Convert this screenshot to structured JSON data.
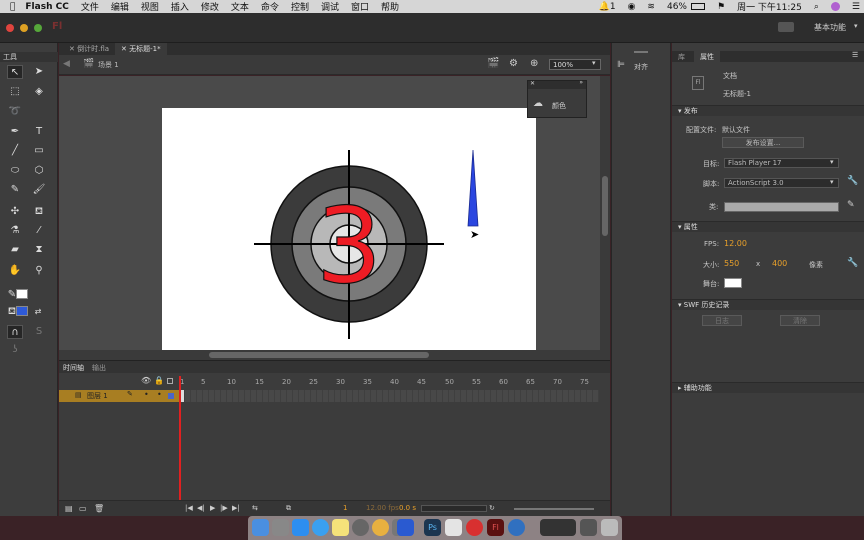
{
  "menubar": {
    "apple": "",
    "app": "Flash CC",
    "menus": [
      "文件",
      "编辑",
      "视图",
      "插入",
      "修改",
      "文本",
      "命令",
      "控制",
      "调试",
      "窗口",
      "帮助"
    ],
    "notification_count": "1",
    "battery": "46%",
    "clock": "周一 下午11:25"
  },
  "appbar": {
    "logo": "Fl",
    "workspace": "基本功能"
  },
  "tools": {
    "panel_title": "工具"
  },
  "tabs": {
    "doc1": "倒计时.fla",
    "doc2": "无标题-1*"
  },
  "editbar": {
    "scene": "场景 1",
    "zoom": "100%"
  },
  "color_panel": {
    "label": "颜色"
  },
  "stage": {
    "countdown_digit": "3"
  },
  "timeline": {
    "tab_timeline": "时间轴",
    "tab_output": "输出",
    "layer_name": "图层 1",
    "frame_ticks": [
      "1",
      "5",
      "10",
      "15",
      "20",
      "25",
      "30",
      "35",
      "40",
      "45",
      "50",
      "55",
      "60",
      "65",
      "70",
      "75"
    ],
    "current_frame": "1",
    "fps": "12.00 fps",
    "time": "0.0 s"
  },
  "align_panel": {
    "label": "对齐"
  },
  "props": {
    "tab_library": "库",
    "tab_properties": "属性",
    "doc_type": "文档",
    "doc_name": "无标题-1",
    "publish": {
      "header": "发布",
      "profile_label": "配置文件:",
      "profile_value": "默认文件",
      "settings_button": "发布设置...",
      "target_label": "目标:",
      "target_value": "Flash Player 17",
      "script_label": "脚本:",
      "script_value": "ActionScript 3.0",
      "class_label": "类:"
    },
    "properties": {
      "header": "属性",
      "fps_label": "FPS:",
      "fps_value": "12.00",
      "size_label": "大小:",
      "width": "550",
      "x": "x",
      "height": "400",
      "unit": "像素",
      "stage_label": "舞台:",
      "stage_color": "#ffffff"
    },
    "swf": {
      "header": "SWF 历史记录",
      "log_button": "日志",
      "clear_button": "清除"
    },
    "accessibility": {
      "header": "辅助功能"
    }
  }
}
